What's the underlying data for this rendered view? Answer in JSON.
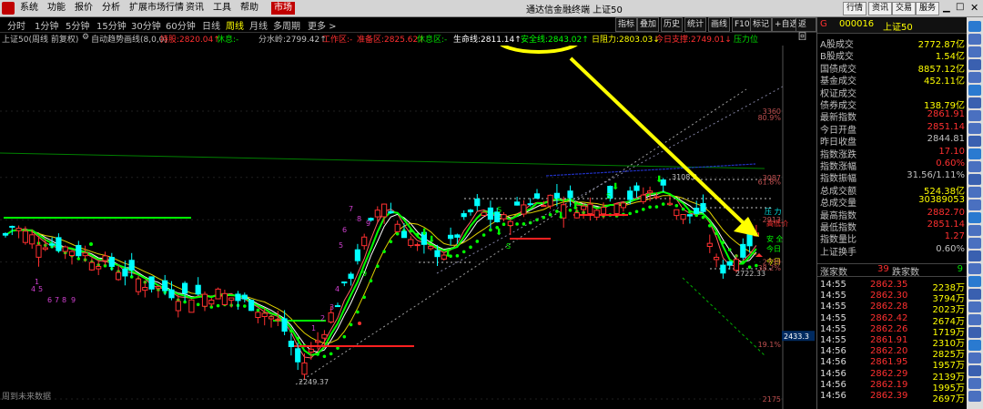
{
  "app": {
    "title": "通达信金融终端 上证50",
    "menus": [
      "系统",
      "功能",
      "报价",
      "分析",
      "扩展市场行情",
      "资讯",
      "工具",
      "帮助",
      "市场"
    ],
    "right_buttons": [
      "行情",
      "资讯",
      "交易",
      "服务"
    ]
  },
  "toolbar": {
    "periods": [
      "分时",
      "1分钟",
      "5分钟",
      "15分钟",
      "30分钟",
      "60分钟",
      "日线",
      "周线",
      "月线",
      "多周期",
      "更多 >"
    ],
    "active_period": "周线",
    "right_buttons": [
      "指标",
      "叠加",
      "历史",
      "统计",
      "画线",
      "F10",
      "标记",
      "+自选",
      "返回"
    ]
  },
  "infoline": {
    "instrument": "上证50(周线 前复权)",
    "indicator": "自动趋势画线(8,0,0)",
    "items": [
      {
        "label": "持股:",
        "value": "2820.04↑",
        "color": "#ff3030"
      },
      {
        "label": "休息:",
        "value": "-",
        "color": "#00e000"
      },
      {
        "label": "分水岭:",
        "value": "2799.42↑",
        "color": "#c0c0c0"
      },
      {
        "label": "工作区:",
        "value": "-",
        "color": "#ff3030"
      },
      {
        "label": "准备区:",
        "value": "2825.62↑",
        "color": "#ff3030"
      },
      {
        "label": "休息区:",
        "value": "-",
        "color": "#00e000"
      },
      {
        "label": "生命线:",
        "value": "2811.14↑",
        "color": "#ffffff"
      },
      {
        "label": "安全线:",
        "value": "2843.02↑",
        "color": "#00ff00"
      },
      {
        "label": "日阻力:",
        "value": "2803.03↓",
        "color": "#ffff00"
      },
      {
        "label": "今日支撑:",
        "value": "2749.01↓",
        "color": "#ff3030"
      },
      {
        "label": "压力位",
        "value": "",
        "color": "#00e000"
      }
    ]
  },
  "chart_data": {
    "type": "candlestick",
    "price_ticks": [
      "3360",
      "3087",
      "2913",
      "2739",
      "2433.3",
      "2175"
    ],
    "pct_ticks": [
      "80.9%",
      "61.8%",
      "38.2%",
      "19.1%"
    ],
    "annotations": {
      "high_label": "3108.0",
      "low_label": "2249.37",
      "recent_label": "2722.33",
      "right_labels": [
        "压 力",
        "高低价",
        "安 全",
        "今日",
        "今日"
      ]
    },
    "bottom_note": "周到未来数据"
  },
  "quote": {
    "code": "000016",
    "name": "上证50",
    "prefix": "G",
    "rows": [
      {
        "label": "A股成交",
        "value": "2772.87亿",
        "color": "#ffff00"
      },
      {
        "label": "B股成交",
        "value": "1.54亿",
        "color": "#ffff00"
      },
      {
        "label": "国债成交",
        "value": "8857.12亿",
        "color": "#ffff00"
      },
      {
        "label": "基金成交",
        "value": "452.11亿",
        "color": "#ffff00"
      },
      {
        "label": "权证成交",
        "value": "",
        "color": "#ffff00"
      },
      {
        "label": "债券成交",
        "value": "138.79亿",
        "color": "#ffff00"
      },
      {
        "label": "最新指数",
        "value": "2861.91",
        "color": "#ff3030"
      },
      {
        "label": "今日开盘",
        "value": "2851.14",
        "color": "#ff3030"
      },
      {
        "label": "昨日收盘",
        "value": "2844.81",
        "color": "#c0c0c0"
      },
      {
        "label": "指数涨跌",
        "value": "17.10",
        "color": "#ff3030"
      },
      {
        "label": "指数涨幅",
        "value": "0.60%",
        "color": "#ff3030"
      },
      {
        "label": "指数振幅",
        "value": "31.56/1.11%",
        "color": "#c0c0c0"
      },
      {
        "label": "总成交额",
        "value": "524.38亿",
        "color": "#ffff00"
      },
      {
        "label": "总成交量",
        "value": "30389053",
        "color": "#ffff00"
      },
      {
        "label": "最高指数",
        "value": "2882.70",
        "color": "#ff3030"
      },
      {
        "label": "最低指数",
        "value": "2851.14",
        "color": "#ff3030"
      },
      {
        "label": "指数量比",
        "value": "1.27",
        "color": "#ff3030"
      },
      {
        "label": "上证换手",
        "value": "0.60%",
        "color": "#c0c0c0"
      }
    ],
    "updown": {
      "up_label": "涨家数",
      "up": "39",
      "down_label": "跌家数",
      "down": "9"
    },
    "ticks": [
      {
        "time": "14:55",
        "price": "2862.35",
        "vol": "2238万"
      },
      {
        "time": "14:55",
        "price": "2862.30",
        "vol": "3794万"
      },
      {
        "time": "14:55",
        "price": "2862.28",
        "vol": "2023万"
      },
      {
        "time": "14:55",
        "price": "2862.42",
        "vol": "2674万"
      },
      {
        "time": "14:55",
        "price": "2862.26",
        "vol": "1719万"
      },
      {
        "time": "14:55",
        "price": "2861.91",
        "vol": "2310万"
      },
      {
        "time": "14:56",
        "price": "2862.20",
        "vol": "2825万"
      },
      {
        "time": "14:56",
        "price": "2861.95",
        "vol": "1957万"
      },
      {
        "time": "14:56",
        "price": "2862.29",
        "vol": "2139万"
      },
      {
        "time": "14:56",
        "price": "2862.19",
        "vol": "1995万"
      },
      {
        "time": "14:56",
        "price": "2862.39",
        "vol": "2697万"
      }
    ]
  },
  "colors": {
    "up": "#ff3030",
    "down": "#00ffff",
    "highlight": "#ffff00"
  }
}
